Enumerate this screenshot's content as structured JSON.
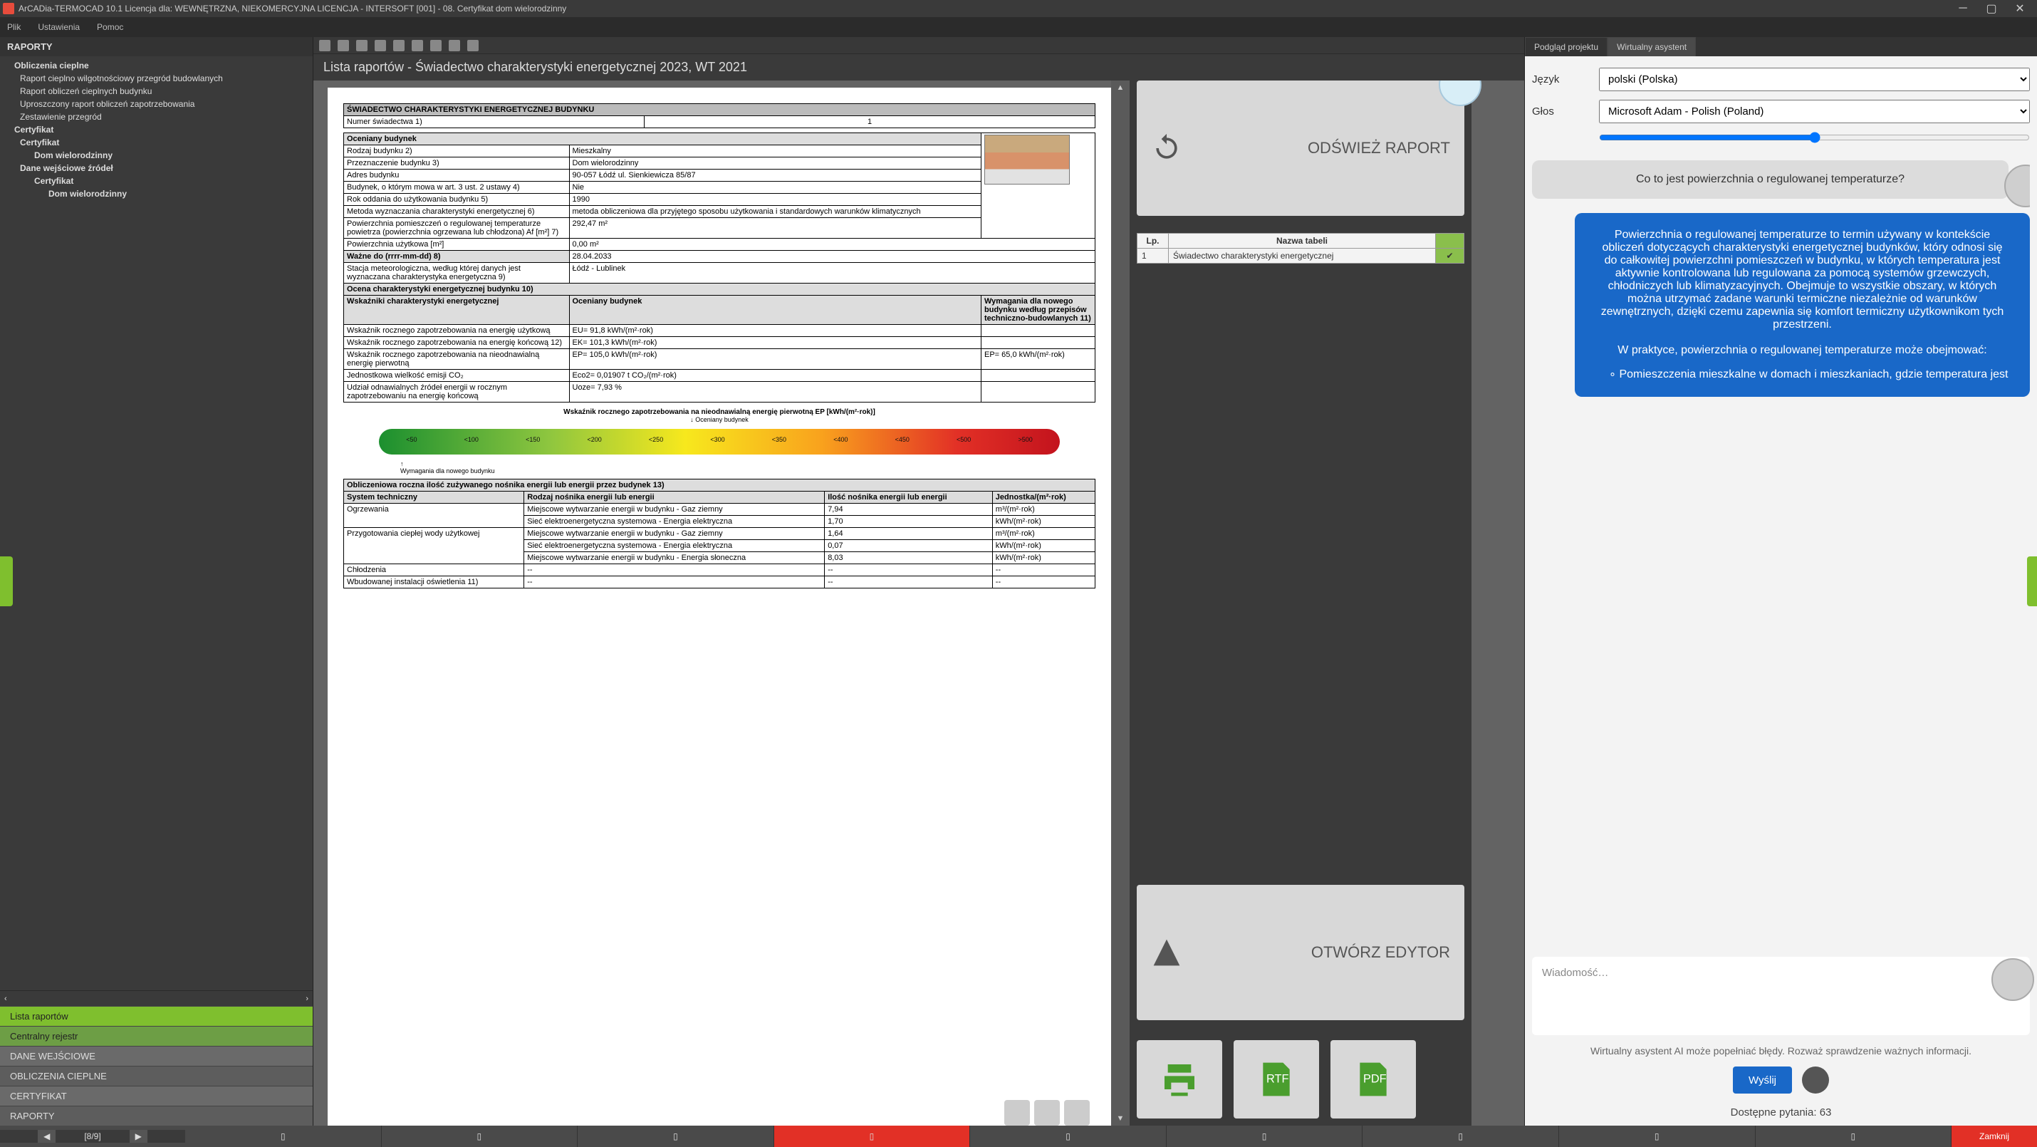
{
  "window": {
    "title": "ArCADia-TERMOCAD 10.1 Licencja dla: WEWNĘTRZNA, NIEKOMERCYJNA LICENCJA - INTERSOFT [001] - 08. Certyfikat dom wielorodzinny"
  },
  "menu": {
    "file": "Plik",
    "settings": "Ustawienia",
    "help": "Pomoc"
  },
  "left": {
    "header": "RAPORTY",
    "tree": {
      "g1": "Obliczenia cieplne",
      "g1_1": "Raport cieplno wilgotnościowy przegród budowlanych",
      "g1_2": "Raport obliczeń cieplnych budynku",
      "g1_3": "Uproszczony raport obliczeń zapotrzebowania",
      "g1_4": "Zestawienie przegród",
      "g2": "Certyfikat",
      "g2_1": "Certyfikat",
      "g2_1_1": "Dom wielorodzinny",
      "g2_2": "Dane wejściowe źródeł",
      "g2_2_1": "Certyfikat",
      "g2_2_1_1": "Dom wielorodzinny"
    },
    "bottomTabs": {
      "t1": "Lista raportów",
      "t2": "Centralny rejestr",
      "t3": "DANE WEJŚCIOWE",
      "t4": "OBLICZENIA CIEPLNE",
      "t5": "CERTYFIKAT",
      "t6": "RAPORTY"
    }
  },
  "center": {
    "header": "Lista raportów - Świadectwo charakterystyki energetycznej 2023, WT 2021",
    "refresh": "ODŚWIEŻ RAPORT",
    "editor": "OTWÓRZ EDYTOR",
    "tableHeaderLp": "Lp.",
    "tableHeaderName": "Nazwa tabeli",
    "tableRowLp": "1",
    "tableRowName": "Świadectwo charakterystyki energetycznej",
    "rtf": "RTF",
    "pdf": "PDF"
  },
  "doc": {
    "title": "ŚWIADECTWO CHARAKTERYSTYKI ENERGETYCZNEJ BUDYNKU",
    "numLabel": "Numer świadectwa     1)",
    "numVal": "1",
    "sec_budynek": "Oceniany budynek",
    "r1k": "Rodzaj budynku 2)",
    "r1v": "Mieszkalny",
    "r2k": "Przeznaczenie budynku 3)",
    "r2v": "Dom wielorodzinny",
    "r3k": "Adres budynku",
    "r3v": "90-057 Łódź ul. Sienkiewicza 85/87",
    "r4k": "Budynek, o którym mowa w art. 3 ust. 2 ustawy 4)",
    "r4v": "Nie",
    "r5k": "Rok oddania do użytkowania budynku 5)",
    "r5v": "1990",
    "r6k": "Metoda wyznaczania charakterystyki energetycznej 6)",
    "r6v": "metoda obliczeniowa dla przyjętego sposobu użytkowania i standardowych warunków klimatycznych",
    "r7k": "Powierzchnia pomieszczeń o regulowanej temperaturze powietrza (powierzchnia ogrzewana lub chłodzona) Af [m²] 7)",
    "r7v": "292,47 m²",
    "r8k": "Powierzchnia użytkowa [m²]",
    "r8v": "0,00 m²",
    "r9k": "Ważne do (rrrr-mm-dd) 8)",
    "r9v": "28.04.2033",
    "r10k": "Stacja meteorologiczna, według której danych jest wyznaczana charakterystyka energetyczna 9)",
    "r10v": "Łódź - Lublinek",
    "sec_ocena": "Ocena charakterystyki energetycznej budynku 10)",
    "col1": "Wskaźniki charakterystyki energetycznej",
    "col2": "Oceniany budynek",
    "col3": "Wymagania dla nowego budynku według przepisów techniczno-budowlanych 11)",
    "w1k": "Wskaźnik rocznego zapotrzebowania na energię użytkową",
    "w1v": "EU= 91,8 kWh/(m²·rok)",
    "w2k": "Wskaźnik rocznego zapotrzebowania na energię końcową 12)",
    "w2v": "EK= 101,3 kWh/(m²·rok)",
    "w3k": "Wskaźnik rocznego zapotrzebowania na nieodnawialną energię pierwotną",
    "w3v": "EP= 105,0 kWh/(m²·rok)",
    "w3req": "EP= 65,0 kWh/(m²·rok)",
    "w4k": "Jednostkowa wielkość emisji CO₂",
    "w4v": "Eco2= 0,01907 t CO₂/(m²·rok)",
    "w5k": "Udział odnawialnych źródeł energii w rocznym zapotrzebowaniu na energię końcową",
    "w5v": "Uoze= 7,93 %",
    "barTitle": "Wskaźnik rocznego zapotrzebowania na nieodnawialną energię pierwotną EP [kWh/(m²·rok)]",
    "barPointer": "Oceniany budynek",
    "barReq": "Wymagania dla nowego budynku",
    "scale": [
      "<50",
      "<100",
      "<150",
      "<200",
      "<250",
      "<300",
      "<350",
      "<400",
      "<450",
      "<500",
      ">500"
    ],
    "sec_obl": "Obliczeniowa roczna ilość zużywanego nośnika energii lub energii przez budynek 13)",
    "oc_col1": "System techniczny",
    "oc_col2": "Rodzaj nośnika energii lub energii",
    "oc_col3": "Ilość nośnika energii lub energii",
    "oc_col4": "Jednostka/(m²·rok)",
    "oc_r1_1": "Ogrzewania",
    "oc_r1_2": "Miejscowe wytwarzanie energii w budynku - Gaz ziemny",
    "oc_r1_3": "7,94",
    "oc_r1_4": "m³/(m²·rok)",
    "oc_r2_2": "Sieć elektroenergetyczna systemowa - Energia elektryczna",
    "oc_r2_3": "1,70",
    "oc_r2_4": "kWh/(m²·rok)",
    "oc_r3_1": "Przygotowania ciepłej wody użytkowej",
    "oc_r3_2": "Miejscowe wytwarzanie energii w budynku - Gaz ziemny",
    "oc_r3_3": "1,64",
    "oc_r3_4": "m³/(m²·rok)",
    "oc_r4_2": "Sieć elektroenergetyczna systemowa - Energia elektryczna",
    "oc_r4_3": "0,07",
    "oc_r4_4": "kWh/(m²·rok)",
    "oc_r5_2": "Miejscowe wytwarzanie energii w budynku - Energia słoneczna",
    "oc_r5_3": "8,03",
    "oc_r5_4": "kWh/(m²·rok)",
    "oc_r6_1": "Chłodzenia",
    "oc_r6_2": "--",
    "oc_r6_3": "--",
    "oc_r6_4": "--",
    "oc_r7_1": "Wbudowanej instalacji oświetlenia 11)",
    "oc_r7_2": "--",
    "oc_r7_3": "--",
    "oc_r7_4": "--"
  },
  "assistant": {
    "tab1": "Podgląd projektu",
    "tab2": "Wirtualny asystent",
    "lang_lbl": "Język",
    "lang_val": "polski (Polska)",
    "voice_lbl": "Głos",
    "voice_val": "Microsoft Adam - Polish (Poland)",
    "user_q": "Co to jest powierzchnia o regulowanej temperaturze?",
    "bot_a1": "Powierzchnia o regulowanej temperaturze to termin używany w kontekście obliczeń dotyczących charakterystyki energetycznej budynków, który odnosi się do całkowitej powierzchni pomieszczeń w budynku, w których temperatura jest aktywnie kontrolowana lub regulowana za pomocą systemów grzewczych, chłodniczych lub klimatyzacyjnych. Obejmuje to wszystkie obszary, w których można utrzymać zadane warunki termiczne niezależnie od warunków zewnętrznych, dzięki czemu zapewnia się komfort termiczny użytkownikom tych przestrzeni.",
    "bot_a2": "W praktyce, powierzchnia o regulowanej temperaturze może obejmować:",
    "bot_a3": "Pomieszczenia mieszkalne w domach i mieszkaniach, gdzie temperatura jest",
    "placeholder": "Wiadomość…",
    "disclaimer": "Wirtualny asystent AI może popełniać błędy. Rozważ sprawdzenie ważnych informacji.",
    "send": "Wyślij",
    "avail": "Dostępne pytania: 63"
  },
  "bottom": {
    "page": "[8/9]",
    "close": "Zamknij"
  }
}
